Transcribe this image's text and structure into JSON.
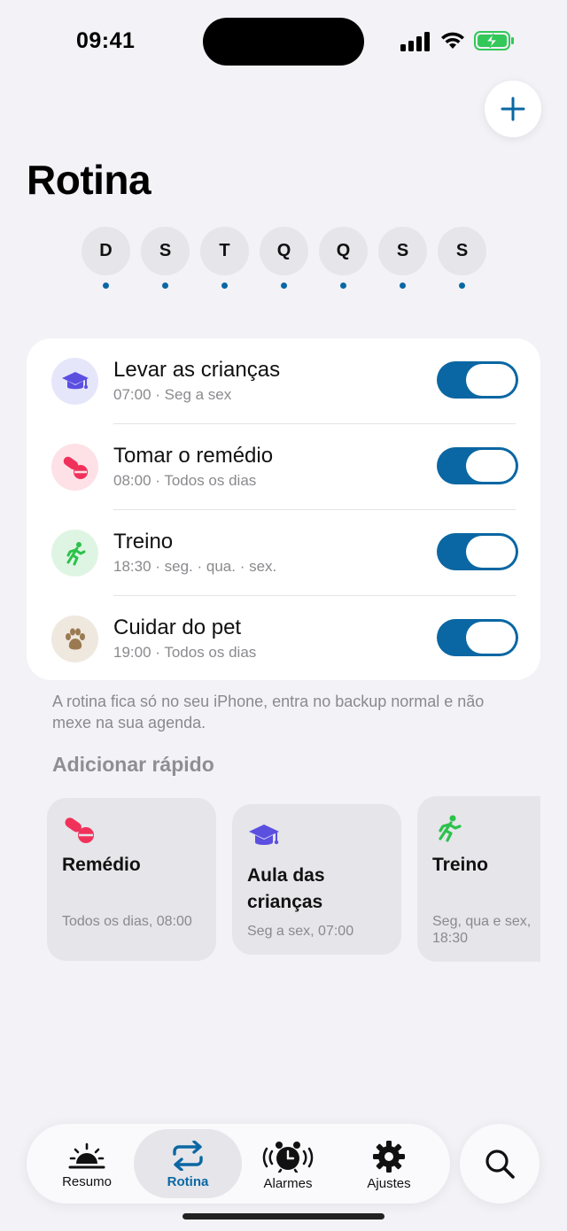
{
  "status": {
    "time": "09:41"
  },
  "header": {
    "title": "Rotina"
  },
  "days": [
    {
      "label": "D"
    },
    {
      "label": "S"
    },
    {
      "label": "T"
    },
    {
      "label": "Q"
    },
    {
      "label": "Q"
    },
    {
      "label": "S"
    },
    {
      "label": "S"
    }
  ],
  "routines": [
    {
      "title": "Levar as crianças",
      "subtitle": "07:00 · Seg a sex",
      "icon": "graduation-cap-icon",
      "icon_bg": "#e6e6fb",
      "icon_color": "#5b4fe0",
      "enabled": true
    },
    {
      "title": "Tomar o remédio",
      "subtitle": "08:00 · Todos os dias",
      "icon": "pills-icon",
      "icon_bg": "#fde1e6",
      "icon_color": "#f0325a",
      "enabled": true
    },
    {
      "title": "Treino",
      "subtitle": "18:30 · seg. · qua. · sex.",
      "icon": "running-figure-icon",
      "icon_bg": "#dff5e3",
      "icon_color": "#2bc24a",
      "enabled": true
    },
    {
      "title": "Cuidar do pet",
      "subtitle": "19:00 · Todos os dias",
      "icon": "paw-icon",
      "icon_bg": "#efe8df",
      "icon_color": "#9b7a52",
      "enabled": true
    }
  ],
  "footnote": "A rotina fica só no seu iPhone, entra no backup normal e não mexe na sua agenda.",
  "quick_add": {
    "title": "Adicionar rápido",
    "cards": [
      {
        "title": "Remédio",
        "subtitle": "Todos os dias, 08:00",
        "icon": "pills-icon"
      },
      {
        "title": "Aula das crianças",
        "subtitle": "Seg a sex, 07:00",
        "icon": "graduation-cap-icon"
      },
      {
        "title": "Treino",
        "subtitle": "Seg, qua e sex, 18:30",
        "icon": "running-figure-icon"
      }
    ]
  },
  "tabs": [
    {
      "label": "Resumo",
      "icon": "sunrise-icon",
      "active": false
    },
    {
      "label": "Rotina",
      "icon": "repeat-icon",
      "active": true
    },
    {
      "label": "Alarmes",
      "icon": "alarm-clock-icon",
      "active": false
    },
    {
      "label": "Ajustes",
      "icon": "gear-icon",
      "active": false
    }
  ],
  "colors": {
    "accent": "#0a67a3",
    "background": "#f2f2f7",
    "card": "#ffffff",
    "battery": "#34c759"
  }
}
